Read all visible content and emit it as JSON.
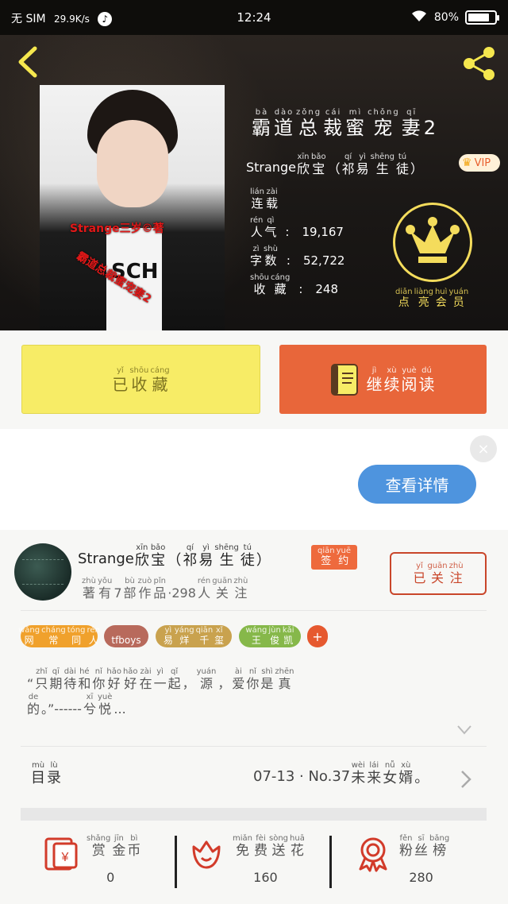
{
  "status_bar": {
    "carrier": "无 SIM",
    "speed": "29.9K/s",
    "time": "12:24",
    "battery": "80%",
    "battery_level": 0.8
  },
  "book": {
    "title": [
      [
        "bà",
        "霸"
      ],
      [
        "dào",
        "道"
      ],
      [
        "zǒng",
        "总"
      ],
      [
        "cái",
        "裁"
      ],
      [
        "mì",
        "蜜"
      ],
      [
        "chǒng",
        "宠"
      ],
      [
        "qī",
        "妻"
      ],
      [
        "",
        "2"
      ]
    ],
    "author": "Strange",
    "author_suffix": [
      [
        "xīn",
        "欣"
      ],
      [
        "bǎo",
        "宝"
      ],
      [
        "",
        "（"
      ],
      [
        "qí",
        "祁"
      ],
      [
        "yì",
        "易"
      ],
      [
        "shēng",
        "生"
      ],
      [
        "tú",
        "徒"
      ],
      [
        "",
        "）"
      ]
    ],
    "vip_label": "VIP",
    "status": {
      "label": [
        [
          "lián",
          "连"
        ],
        [
          "zài",
          "载"
        ]
      ]
    },
    "popularity": {
      "label": [
        [
          "rén",
          "人"
        ],
        [
          "qì",
          "气"
        ]
      ],
      "value": "19,167"
    },
    "word_count": {
      "label": [
        [
          "zì",
          "字"
        ],
        [
          "shù",
          "数"
        ]
      ],
      "value": "52,722"
    },
    "favorites": {
      "label": [
        [
          "shōu",
          "收"
        ],
        [
          "cáng",
          "藏"
        ]
      ],
      "value": "248"
    },
    "cover_watermark_1": "Strange三岁©著",
    "cover_watermark_2": "霸道总裁蜜宠妻2",
    "cover_shirt_text": "SCH",
    "member_label": [
      [
        "diǎn",
        "点"
      ],
      [
        "liàng",
        "亮"
      ],
      [
        "huì",
        "会"
      ],
      [
        "yuán",
        "员"
      ]
    ]
  },
  "actions": {
    "collected": [
      [
        "yǐ",
        "已"
      ],
      [
        "shōu",
        "收"
      ],
      [
        "cáng",
        "藏"
      ]
    ],
    "continue_read": [
      [
        "jì",
        "继"
      ],
      [
        "xù",
        "续"
      ],
      [
        "yuè",
        "阅"
      ],
      [
        "dú",
        "读"
      ]
    ]
  },
  "ad": {
    "close": "×",
    "details": "查看详情"
  },
  "author_card": {
    "name": "Strange",
    "name_suffix": [
      [
        "xīn",
        "欣"
      ],
      [
        "bǎo",
        "宝"
      ],
      [
        "",
        "（"
      ],
      [
        "qí",
        "祁"
      ],
      [
        "yì",
        "易"
      ],
      [
        "shēng",
        "生"
      ],
      [
        "tú",
        "徒"
      ],
      [
        "",
        "）"
      ]
    ],
    "sign_badge": [
      [
        "qiān",
        "签"
      ],
      [
        "yuē",
        "约"
      ]
    ],
    "sub": [
      [
        "zhù",
        "著"
      ],
      [
        "yǒu",
        "有"
      ],
      [
        "",
        "7"
      ],
      [
        "bù",
        "部"
      ],
      [
        "zuò",
        "作"
      ],
      [
        "pǐn",
        "品"
      ],
      [
        "",
        "·298"
      ],
      [
        "rén",
        "人"
      ],
      [
        "guān",
        "关"
      ],
      [
        "zhù",
        "注"
      ]
    ],
    "follow": [
      [
        "yǐ",
        "已"
      ],
      [
        "guān",
        "关"
      ],
      [
        "zhù",
        "注"
      ]
    ],
    "tags": [
      {
        "text": [
          [
            "wǎng",
            "网"
          ],
          [
            "cháng",
            "常"
          ],
          [
            "tóng",
            "同"
          ],
          [
            "rén",
            "人"
          ]
        ],
        "color": "#f0a12c"
      },
      {
        "text": [
          [
            "",
            "tfboys"
          ]
        ],
        "color": "#b86a5c"
      },
      {
        "text": [
          [
            "yì",
            "易"
          ],
          [
            "yáng",
            "烊"
          ],
          [
            "qiān",
            "千"
          ],
          [
            "xǐ",
            "玺"
          ]
        ],
        "color": "#c9a24e"
      },
      {
        "text": [
          [
            "wáng",
            "王"
          ],
          [
            "jùn",
            "俊"
          ],
          [
            "kǎi",
            "凯"
          ]
        ],
        "color": "#86b84a"
      }
    ],
    "add_tag": "+",
    "quote_line1": [
      [
        "",
        "“"
      ],
      [
        "zhǐ",
        "只"
      ],
      [
        "qī",
        "期"
      ],
      [
        "dài",
        "待"
      ],
      [
        "hé",
        "和"
      ],
      [
        "nǐ",
        "你"
      ],
      [
        "hǎo",
        "好"
      ],
      [
        "hǎo",
        "好"
      ],
      [
        "zài",
        "在"
      ],
      [
        "yì",
        "一"
      ],
      [
        "qǐ",
        "起"
      ],
      [
        "",
        "，"
      ],
      [
        "yuán",
        "源"
      ],
      [
        "",
        "，"
      ],
      [
        "ài",
        "爱"
      ],
      [
        "nǐ",
        "你"
      ],
      [
        "shì",
        "是"
      ],
      [
        "zhēn",
        "真"
      ]
    ],
    "quote_line2": [
      [
        "de",
        "的"
      ],
      [
        "",
        "。”------"
      ],
      [
        "xī",
        "兮"
      ],
      [
        "yuè",
        "悦"
      ],
      [
        "",
        "..."
      ]
    ]
  },
  "toc": {
    "label": [
      [
        "mù",
        "目"
      ],
      [
        "lù",
        "录"
      ]
    ],
    "latest_prefix": "07-13 · No.37",
    "latest_title": [
      [
        "wèi",
        "未"
      ],
      [
        "lái",
        "来"
      ],
      [
        "nǚ",
        "女"
      ],
      [
        "xù",
        "婿"
      ],
      [
        "",
        "。"
      ]
    ]
  },
  "bottom_stats": [
    {
      "label": [
        [
          "shǎng",
          "赏"
        ],
        [
          "jīn",
          "金"
        ],
        [
          "bì",
          "币"
        ]
      ],
      "value": "0"
    },
    {
      "label": [
        [
          "miǎn",
          "免"
        ],
        [
          "fèi",
          "费"
        ],
        [
          "sòng",
          "送"
        ],
        [
          "huā",
          "花"
        ]
      ],
      "value": "160"
    },
    {
      "label": [
        [
          "fěn",
          "粉"
        ],
        [
          "sī",
          "丝"
        ],
        [
          "bǎng",
          "榜"
        ]
      ],
      "value": "280"
    }
  ],
  "colors": {
    "accent_yellow": "#f7ec66",
    "accent_orange": "#e8663a",
    "crown_gold": "#f4dc5c",
    "button_blue": "#4e94de"
  }
}
